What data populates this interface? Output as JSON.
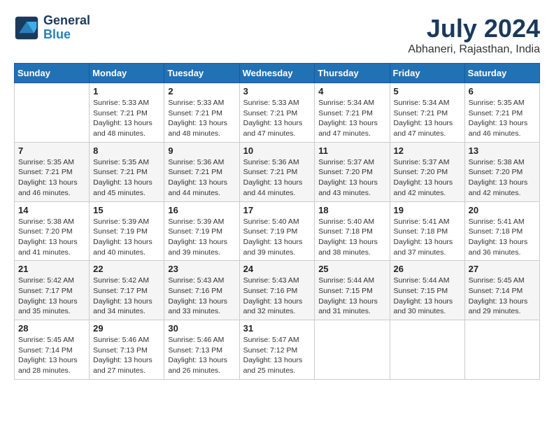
{
  "header": {
    "logo_line1": "General",
    "logo_line2": "Blue",
    "month_year": "July 2024",
    "location": "Abhaneri, Rajasthan, India"
  },
  "weekdays": [
    "Sunday",
    "Monday",
    "Tuesday",
    "Wednesday",
    "Thursday",
    "Friday",
    "Saturday"
  ],
  "weeks": [
    [
      {
        "day": "",
        "info": ""
      },
      {
        "day": "1",
        "info": "Sunrise: 5:33 AM\nSunset: 7:21 PM\nDaylight: 13 hours\nand 48 minutes."
      },
      {
        "day": "2",
        "info": "Sunrise: 5:33 AM\nSunset: 7:21 PM\nDaylight: 13 hours\nand 48 minutes."
      },
      {
        "day": "3",
        "info": "Sunrise: 5:33 AM\nSunset: 7:21 PM\nDaylight: 13 hours\nand 47 minutes."
      },
      {
        "day": "4",
        "info": "Sunrise: 5:34 AM\nSunset: 7:21 PM\nDaylight: 13 hours\nand 47 minutes."
      },
      {
        "day": "5",
        "info": "Sunrise: 5:34 AM\nSunset: 7:21 PM\nDaylight: 13 hours\nand 47 minutes."
      },
      {
        "day": "6",
        "info": "Sunrise: 5:35 AM\nSunset: 7:21 PM\nDaylight: 13 hours\nand 46 minutes."
      }
    ],
    [
      {
        "day": "7",
        "info": "Sunrise: 5:35 AM\nSunset: 7:21 PM\nDaylight: 13 hours\nand 46 minutes."
      },
      {
        "day": "8",
        "info": "Sunrise: 5:35 AM\nSunset: 7:21 PM\nDaylight: 13 hours\nand 45 minutes."
      },
      {
        "day": "9",
        "info": "Sunrise: 5:36 AM\nSunset: 7:21 PM\nDaylight: 13 hours\nand 44 minutes."
      },
      {
        "day": "10",
        "info": "Sunrise: 5:36 AM\nSunset: 7:21 PM\nDaylight: 13 hours\nand 44 minutes."
      },
      {
        "day": "11",
        "info": "Sunrise: 5:37 AM\nSunset: 7:20 PM\nDaylight: 13 hours\nand 43 minutes."
      },
      {
        "day": "12",
        "info": "Sunrise: 5:37 AM\nSunset: 7:20 PM\nDaylight: 13 hours\nand 42 minutes."
      },
      {
        "day": "13",
        "info": "Sunrise: 5:38 AM\nSunset: 7:20 PM\nDaylight: 13 hours\nand 42 minutes."
      }
    ],
    [
      {
        "day": "14",
        "info": "Sunrise: 5:38 AM\nSunset: 7:20 PM\nDaylight: 13 hours\nand 41 minutes."
      },
      {
        "day": "15",
        "info": "Sunrise: 5:39 AM\nSunset: 7:19 PM\nDaylight: 13 hours\nand 40 minutes."
      },
      {
        "day": "16",
        "info": "Sunrise: 5:39 AM\nSunset: 7:19 PM\nDaylight: 13 hours\nand 39 minutes."
      },
      {
        "day": "17",
        "info": "Sunrise: 5:40 AM\nSunset: 7:19 PM\nDaylight: 13 hours\nand 39 minutes."
      },
      {
        "day": "18",
        "info": "Sunrise: 5:40 AM\nSunset: 7:18 PM\nDaylight: 13 hours\nand 38 minutes."
      },
      {
        "day": "19",
        "info": "Sunrise: 5:41 AM\nSunset: 7:18 PM\nDaylight: 13 hours\nand 37 minutes."
      },
      {
        "day": "20",
        "info": "Sunrise: 5:41 AM\nSunset: 7:18 PM\nDaylight: 13 hours\nand 36 minutes."
      }
    ],
    [
      {
        "day": "21",
        "info": "Sunrise: 5:42 AM\nSunset: 7:17 PM\nDaylight: 13 hours\nand 35 minutes."
      },
      {
        "day": "22",
        "info": "Sunrise: 5:42 AM\nSunset: 7:17 PM\nDaylight: 13 hours\nand 34 minutes."
      },
      {
        "day": "23",
        "info": "Sunrise: 5:43 AM\nSunset: 7:16 PM\nDaylight: 13 hours\nand 33 minutes."
      },
      {
        "day": "24",
        "info": "Sunrise: 5:43 AM\nSunset: 7:16 PM\nDaylight: 13 hours\nand 32 minutes."
      },
      {
        "day": "25",
        "info": "Sunrise: 5:44 AM\nSunset: 7:15 PM\nDaylight: 13 hours\nand 31 minutes."
      },
      {
        "day": "26",
        "info": "Sunrise: 5:44 AM\nSunset: 7:15 PM\nDaylight: 13 hours\nand 30 minutes."
      },
      {
        "day": "27",
        "info": "Sunrise: 5:45 AM\nSunset: 7:14 PM\nDaylight: 13 hours\nand 29 minutes."
      }
    ],
    [
      {
        "day": "28",
        "info": "Sunrise: 5:45 AM\nSunset: 7:14 PM\nDaylight: 13 hours\nand 28 minutes."
      },
      {
        "day": "29",
        "info": "Sunrise: 5:46 AM\nSunset: 7:13 PM\nDaylight: 13 hours\nand 27 minutes."
      },
      {
        "day": "30",
        "info": "Sunrise: 5:46 AM\nSunset: 7:13 PM\nDaylight: 13 hours\nand 26 minutes."
      },
      {
        "day": "31",
        "info": "Sunrise: 5:47 AM\nSunset: 7:12 PM\nDaylight: 13 hours\nand 25 minutes."
      },
      {
        "day": "",
        "info": ""
      },
      {
        "day": "",
        "info": ""
      },
      {
        "day": "",
        "info": ""
      }
    ]
  ]
}
